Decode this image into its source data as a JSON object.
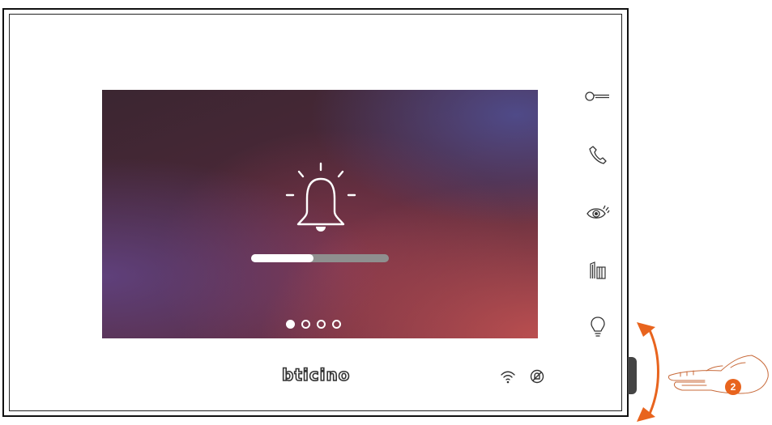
{
  "device": {
    "brand": "bticino",
    "screen": {
      "icon": "bell-icon",
      "progress_fraction": 0.45,
      "page_indicator": {
        "total": 4,
        "active": 1
      }
    },
    "side_buttons": [
      {
        "name": "key-icon",
        "action": "door-lock"
      },
      {
        "name": "phone-icon",
        "action": "answer"
      },
      {
        "name": "eye-icon",
        "action": "camera"
      },
      {
        "name": "gate-icon",
        "action": "gate"
      },
      {
        "name": "lightbulb-icon",
        "action": "light"
      }
    ],
    "status_icons": [
      "wifi-icon",
      "mute-bell-icon"
    ]
  },
  "annotation": {
    "step_number": "2",
    "accent_color": "#e8641e"
  }
}
